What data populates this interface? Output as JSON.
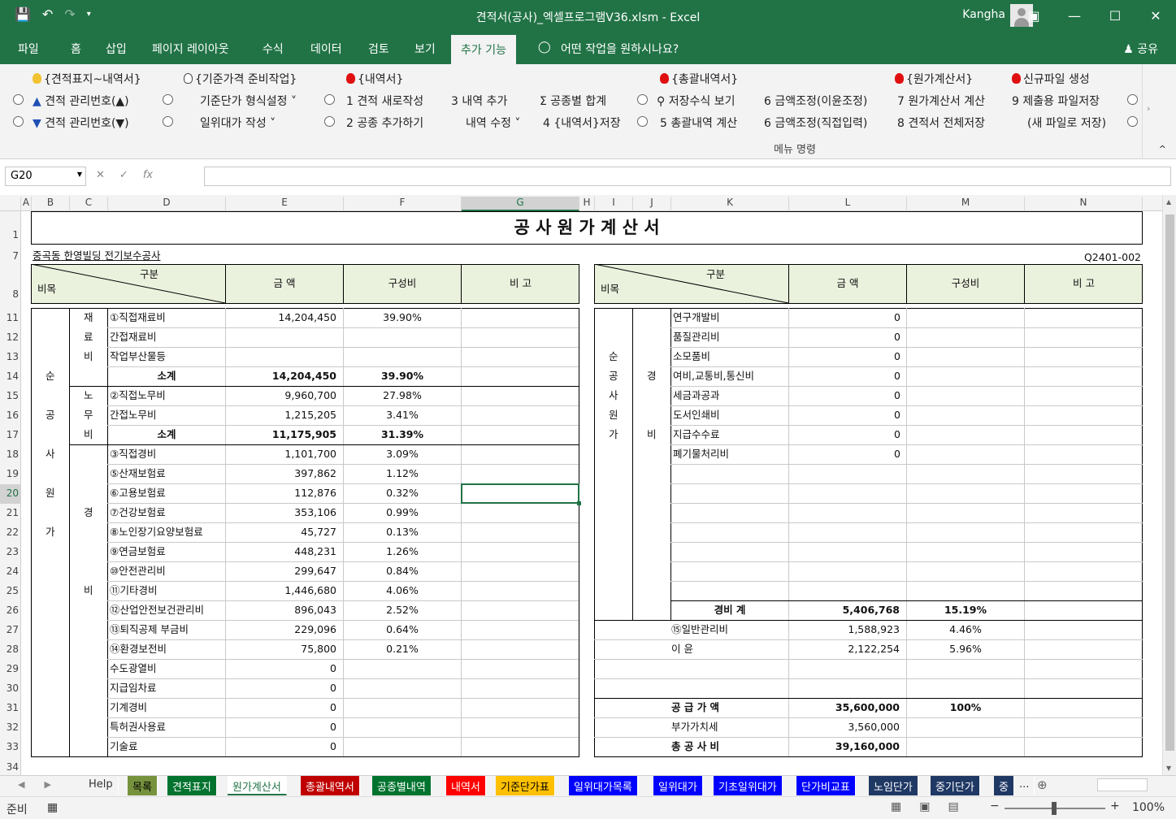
{
  "window": {
    "title": "견적서(공사)_엑셀프로그램V36.xlsm  -  Excel",
    "user": "Kangha"
  },
  "menu": {
    "tabs": [
      "파일",
      "홈",
      "삽입",
      "페이지 레이아웃",
      "수식",
      "데이터",
      "검토",
      "보기",
      "추가 기능"
    ],
    "active": "추가 기능",
    "tell_me": "어떤 작업을 원하시나요?",
    "share": "공유"
  },
  "ribbon": {
    "row1": [
      "{견적표지~내역서}",
      "{기준가격 준비작업}",
      "{내역서}",
      "{총괄내역서}",
      "{원가계산서}",
      "신규파일 생성"
    ],
    "row2": [
      "견적 관리번호(▲)",
      "기준단가 형식설정 ˅",
      "1  견적 새로작성",
      "3  내역 추가",
      "공종별 합계",
      "저장수식 보기",
      "6  금액조정(이윤조정)",
      "7  원가계산서 계산",
      "9  제출용 파일저장"
    ],
    "row3": [
      "견적 관리번호(▼)",
      "일위대가 작성 ˅",
      "2  공종 추가하기",
      "내역 수정 ˅",
      "4  {내역서}저장",
      "5  총괄내역 계산",
      "6  금액조정(직접입력)",
      "8  견적서 전체저장",
      "(새 파일로 저장)"
    ],
    "group": "메뉴 명령"
  },
  "formula_bar": {
    "name_box": "G20",
    "formula": ""
  },
  "columns": [
    "A",
    "B",
    "C",
    "D",
    "E",
    "F",
    "G",
    "H",
    "I",
    "J",
    "K",
    "L",
    "M",
    "N"
  ],
  "rows": [
    "1",
    "7",
    "8",
    "11",
    "12",
    "13",
    "14",
    "15",
    "16",
    "17",
    "18",
    "19",
    "20",
    "21",
    "22",
    "23",
    "24",
    "25",
    "26",
    "27",
    "28",
    "29",
    "30",
    "31",
    "32",
    "33",
    "34"
  ],
  "sheet": {
    "title": "공 사 원 가 계 산 서",
    "project": "중곡동 한영빌딩 전기보수공사",
    "code": "Q2401-002",
    "hdr": {
      "gubun": "구분",
      "bimok": "비목",
      "amount": "금      액",
      "ratio": "구성비",
      "note": "비    고"
    },
    "left_vert": {
      "sun": "순",
      "gong": "공",
      "sa": "사",
      "won": "원",
      "ga": "가",
      "jae": "재",
      "ryo": "료",
      "bi1": "비",
      "no": "노",
      "mu": "무",
      "bi2": "비",
      "gyeong": "경",
      "bi3": "비"
    },
    "left_rows": [
      {
        "name": "①직접재료비",
        "amount": "14,204,450",
        "ratio": "39.90%"
      },
      {
        "name": "간접재료비",
        "amount": "",
        "ratio": ""
      },
      {
        "name": "작업부산물등",
        "amount": "",
        "ratio": ""
      },
      {
        "name": "소계",
        "amount": "14,204,450",
        "ratio": "39.90%"
      },
      {
        "name": "②직접노무비",
        "amount": "9,960,700",
        "ratio": "27.98%"
      },
      {
        "name": "간접노무비",
        "amount": "1,215,205",
        "ratio": "3.41%"
      },
      {
        "name": "소계",
        "amount": "11,175,905",
        "ratio": "31.39%"
      },
      {
        "name": "③직접경비",
        "amount": "1,101,700",
        "ratio": "3.09%"
      },
      {
        "name": "⑤산재보험료",
        "amount": "397,862",
        "ratio": "1.12%"
      },
      {
        "name": "⑥고용보험료",
        "amount": "112,876",
        "ratio": "0.32%"
      },
      {
        "name": "⑦건강보험료",
        "amount": "353,106",
        "ratio": "0.99%"
      },
      {
        "name": "⑧노인장기요양보험료",
        "amount": "45,727",
        "ratio": "0.13%"
      },
      {
        "name": "⑨연금보험료",
        "amount": "448,231",
        "ratio": "1.26%"
      },
      {
        "name": "⑩안전관리비",
        "amount": "299,647",
        "ratio": "0.84%"
      },
      {
        "name": "⑪기타경비",
        "amount": "1,446,680",
        "ratio": "4.06%"
      },
      {
        "name": "⑫산업안전보건관리비",
        "amount": "896,043",
        "ratio": "2.52%"
      },
      {
        "name": "⑬퇴직공제 부금비",
        "amount": "229,096",
        "ratio": "0.64%"
      },
      {
        "name": "⑭환경보전비",
        "amount": "75,800",
        "ratio": "0.21%"
      },
      {
        "name": "수도광열비",
        "amount": "0",
        "ratio": ""
      },
      {
        "name": "지급임차료",
        "amount": "0",
        "ratio": ""
      },
      {
        "name": "기계경비",
        "amount": "0",
        "ratio": ""
      },
      {
        "name": "특허권사용료",
        "amount": "0",
        "ratio": ""
      },
      {
        "name": "기술료",
        "amount": "0",
        "ratio": ""
      }
    ],
    "right_vert": {
      "sun": "순",
      "gong": "공",
      "sa": "사",
      "won": "원",
      "ga": "가",
      "gyeong": "경",
      "bi": "비"
    },
    "right_rows": [
      {
        "name": "연구개발비",
        "amount": "0"
      },
      {
        "name": "품질관리비",
        "amount": "0"
      },
      {
        "name": "소모품비",
        "amount": "0"
      },
      {
        "name": "여비,교통비,통신비",
        "amount": "0"
      },
      {
        "name": "세금과공과",
        "amount": "0"
      },
      {
        "name": "도서인쇄비",
        "amount": "0"
      },
      {
        "name": "지급수수료",
        "amount": "0"
      },
      {
        "name": "폐기물처리비",
        "amount": "0"
      }
    ],
    "right_totals": {
      "gyeongbi": {
        "name": "경비 계",
        "amount": "5,406,768",
        "ratio": "15.19%"
      },
      "admin": {
        "name": "⑮일반관리비",
        "amount": "1,588,923",
        "ratio": "4.46%"
      },
      "profit": {
        "name": "이    윤",
        "amount": "2,122,254",
        "ratio": "5.96%"
      },
      "supply": {
        "name": "공 급 가 액",
        "amount": "35,600,000",
        "ratio": "100%"
      },
      "vat": {
        "name": "부가가치세",
        "amount": "3,560,000"
      },
      "total": {
        "name": "총 공 사 비",
        "amount": "39,160,000"
      }
    }
  },
  "sheet_tabs": [
    {
      "label": "Help",
      "bg": "#f3f3f3",
      "fg": "#333"
    },
    {
      "label": "목록",
      "bg": "#76923c",
      "fg": "#000"
    },
    {
      "label": "견적표지",
      "bg": "#00732e",
      "fg": "#fff"
    },
    {
      "label": "원가계산서",
      "bg": "#ffffff",
      "fg": "#217346"
    },
    {
      "label": "총괄내역서",
      "bg": "#c00000",
      "fg": "#fff"
    },
    {
      "label": "공종별내역",
      "bg": "#00732e",
      "fg": "#fff"
    },
    {
      "label": "내역서",
      "bg": "#ff0000",
      "fg": "#fff"
    },
    {
      "label": "기준단가표",
      "bg": "#ffc000",
      "fg": "#000"
    },
    {
      "label": "일위대가목록",
      "bg": "#0000ff",
      "fg": "#fff"
    },
    {
      "label": "일위대가",
      "bg": "#0000ff",
      "fg": "#fff"
    },
    {
      "label": "기초일위대가",
      "bg": "#0000ff",
      "fg": "#fff"
    },
    {
      "label": "단가비교표",
      "bg": "#0000ff",
      "fg": "#fff"
    },
    {
      "label": "노임단가",
      "bg": "#1f3864",
      "fg": "#fff"
    },
    {
      "label": "중기단가",
      "bg": "#1f3864",
      "fg": "#fff"
    },
    {
      "label": "중",
      "bg": "#1f3864",
      "fg": "#fff"
    }
  ],
  "status": {
    "ready": "준비",
    "zoom": "100%"
  },
  "colors": {
    "excel_green": "#217346",
    "header_fill": "#eaf1dd"
  }
}
